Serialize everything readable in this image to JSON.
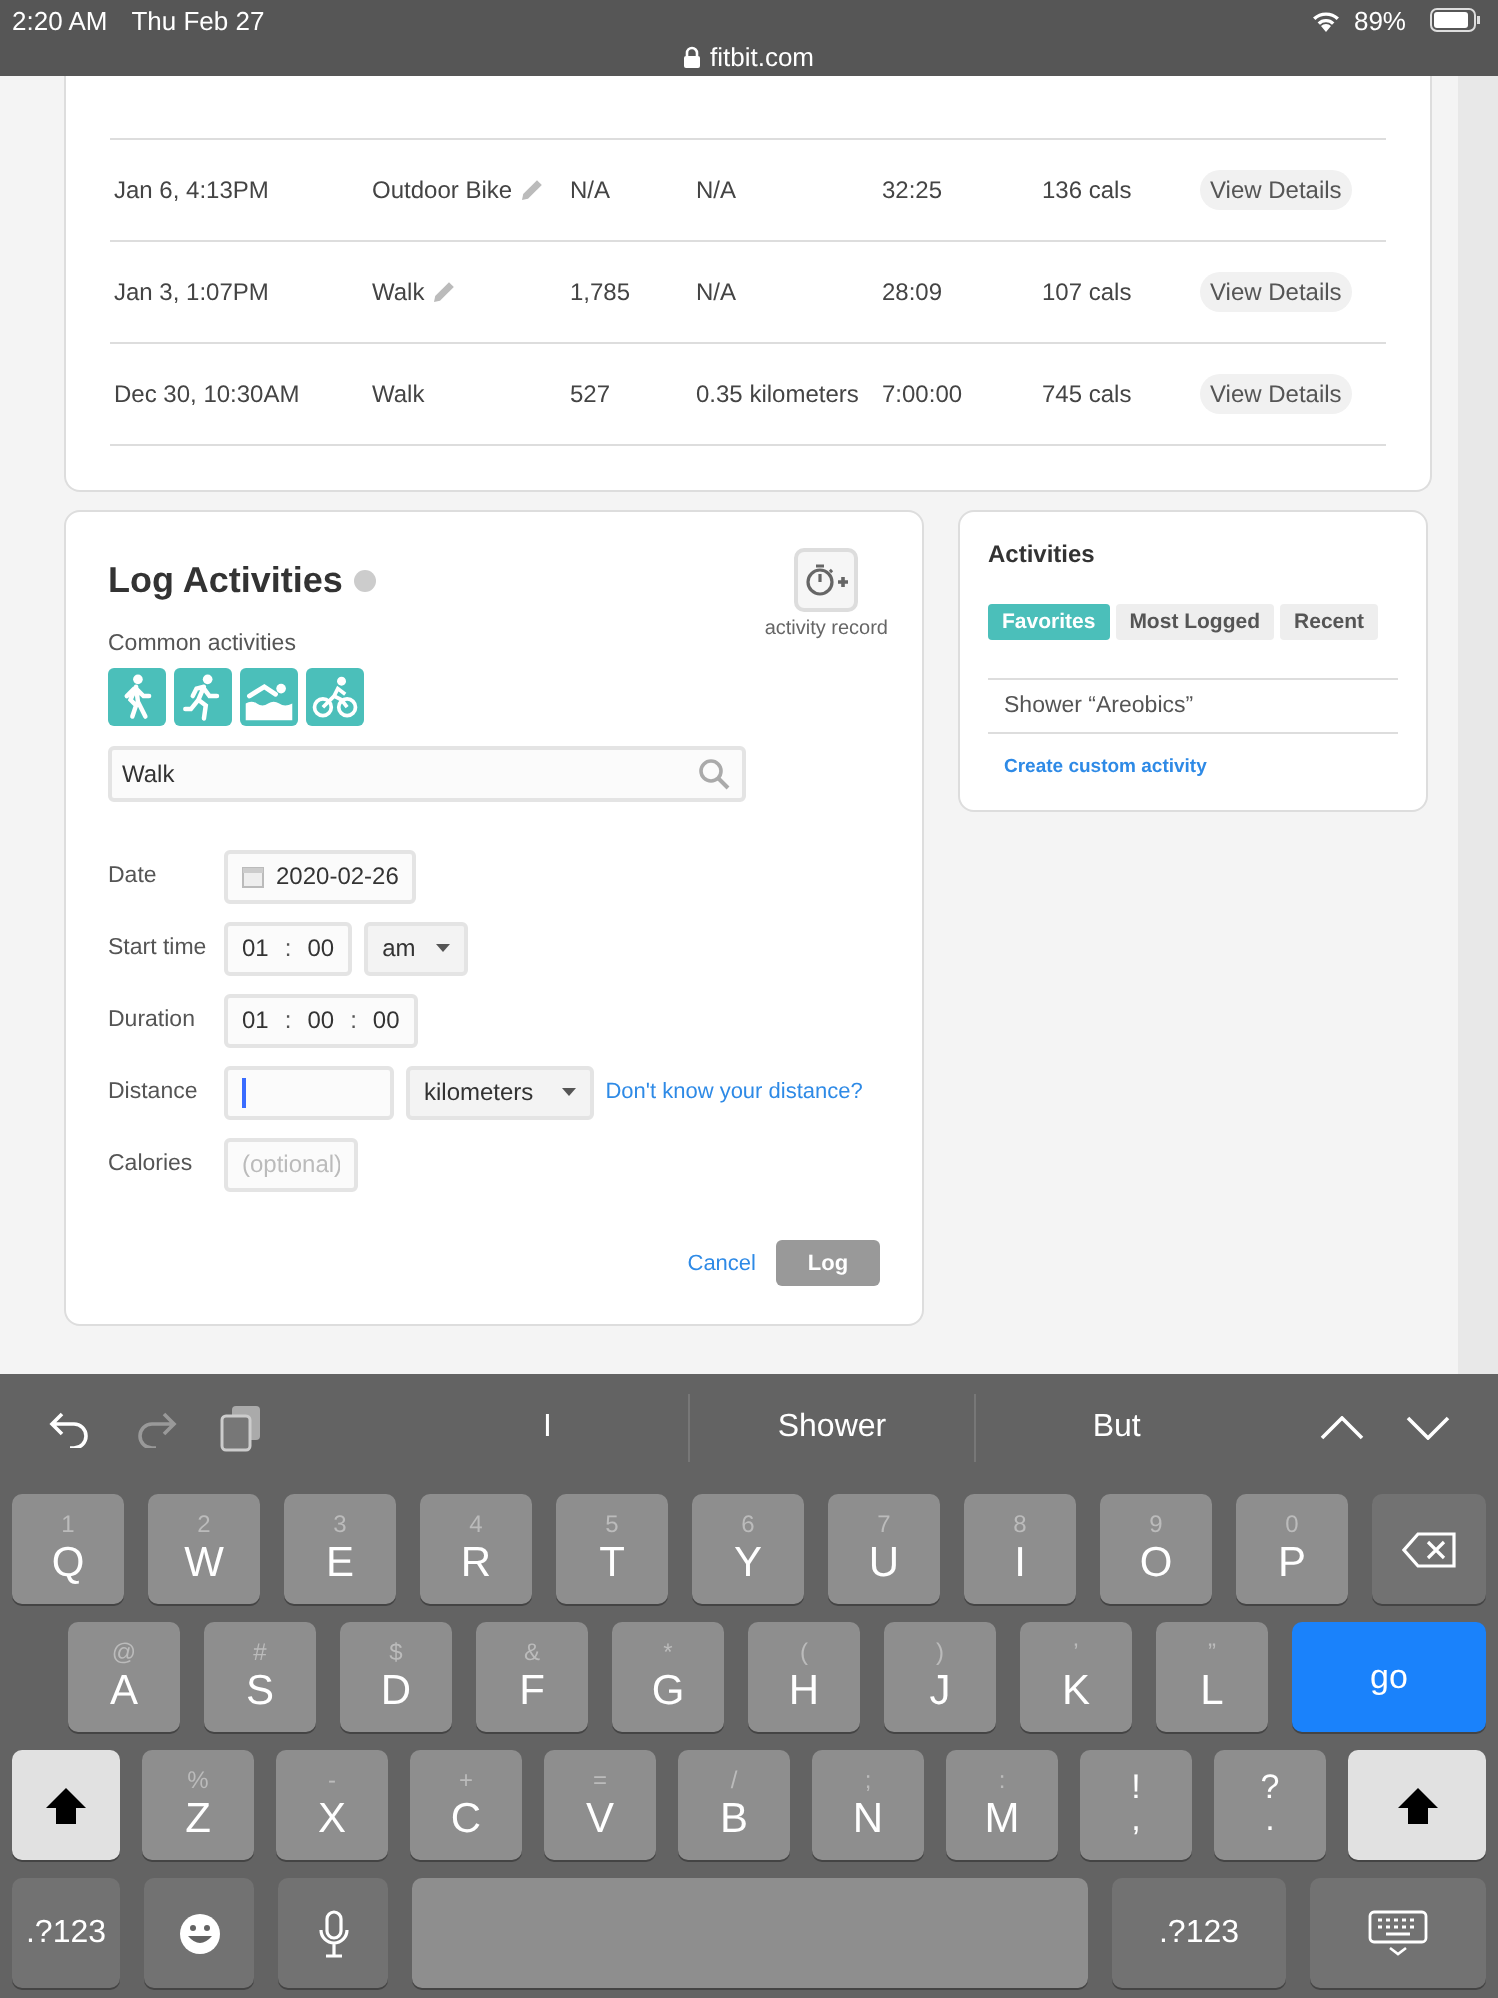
{
  "status_bar": {
    "time": "2:20 AM",
    "date": "Thu Feb 27",
    "battery": "89%",
    "url": "fitbit.com"
  },
  "activity_table": {
    "rows": [
      {
        "date": "Jan 6, 4:13PM",
        "activity": "Outdoor Bike",
        "editable": true,
        "steps": "N/A",
        "distance": "N/A",
        "duration": "32:25",
        "calories": "136 cals",
        "action": "View Details"
      },
      {
        "date": "Jan 3, 1:07PM",
        "activity": "Walk",
        "editable": true,
        "steps": "1,785",
        "distance": "N/A",
        "duration": "28:09",
        "calories": "107 cals",
        "action": "View Details"
      },
      {
        "date": "Dec 30, 10:30AM",
        "activity": "Walk",
        "editable": false,
        "steps": "527",
        "distance": "0.35 kilometers",
        "duration": "7:00:00",
        "calories": "745 cals",
        "action": "View Details"
      }
    ]
  },
  "log_activities": {
    "title": "Log Activities",
    "record_label": "activity record",
    "common_label": "Common activities",
    "common": [
      {
        "kind": "walk"
      },
      {
        "kind": "run"
      },
      {
        "kind": "swim"
      },
      {
        "kind": "bike"
      }
    ],
    "search": {
      "value": "Walk"
    },
    "fields": [
      {
        "kind": "date",
        "label": "Date",
        "value": "2020-02-26"
      },
      {
        "kind": "time",
        "label": "Start time",
        "parts": [
          "01",
          "00"
        ],
        "separator": ":",
        "period": "am"
      },
      {
        "kind": "duration",
        "label": "Duration",
        "parts": [
          "01",
          "00",
          "00"
        ],
        "separator": ":"
      },
      {
        "kind": "distance",
        "label": "Distance",
        "focused": true,
        "unit": "kilometers",
        "link": "Don't know your distance?"
      },
      {
        "kind": "calories",
        "label": "Calories",
        "placeholder": "(optional)"
      }
    ],
    "cancel": "Cancel",
    "submit": "Log"
  },
  "activities_panel": {
    "title": "Activities",
    "tabs": [
      {
        "label": "Favorites",
        "selected": true
      },
      {
        "label": "Most Logged",
        "selected": false
      },
      {
        "label": "Recent",
        "selected": false
      }
    ],
    "items": [
      "Shower “Areobics”"
    ],
    "link": "Create custom activity"
  },
  "keyboard": {
    "suggestions": [
      "I",
      "Shower",
      "But"
    ],
    "rows": [
      [
        {
          "kind": "letter",
          "label": "Q",
          "hint": "1"
        },
        {
          "kind": "letter",
          "label": "W",
          "hint": "2"
        },
        {
          "kind": "letter",
          "label": "E",
          "hint": "3"
        },
        {
          "kind": "letter",
          "label": "R",
          "hint": "4"
        },
        {
          "kind": "letter",
          "label": "T",
          "hint": "5"
        },
        {
          "kind": "letter",
          "label": "Y",
          "hint": "6"
        },
        {
          "kind": "letter",
          "label": "U",
          "hint": "7"
        },
        {
          "kind": "letter",
          "label": "I",
          "hint": "8"
        },
        {
          "kind": "letter",
          "label": "O",
          "hint": "9"
        },
        {
          "kind": "letter",
          "label": "P",
          "hint": "0"
        },
        {
          "kind": "delete"
        }
      ],
      [
        {
          "kind": "letter",
          "label": "A",
          "hint": "@"
        },
        {
          "kind": "letter",
          "label": "S",
          "hint": "#"
        },
        {
          "kind": "letter",
          "label": "D",
          "hint": "$"
        },
        {
          "kind": "letter",
          "label": "F",
          "hint": "&"
        },
        {
          "kind": "letter",
          "label": "G",
          "hint": "*"
        },
        {
          "kind": "letter",
          "label": "H",
          "hint": "("
        },
        {
          "kind": "letter",
          "label": "J",
          "hint": ")"
        },
        {
          "kind": "letter",
          "label": "K",
          "hint": "’"
        },
        {
          "kind": "letter",
          "label": "L",
          "hint": "”"
        },
        {
          "kind": "go",
          "label": "go"
        }
      ],
      [
        {
          "kind": "shift"
        },
        {
          "kind": "letter",
          "label": "Z",
          "hint": "%"
        },
        {
          "kind": "letter",
          "label": "X",
          "hint": "-"
        },
        {
          "kind": "letter",
          "label": "C",
          "hint": "+"
        },
        {
          "kind": "letter",
          "label": "V",
          "hint": "="
        },
        {
          "kind": "letter",
          "label": "B",
          "hint": "/"
        },
        {
          "kind": "letter",
          "label": "N",
          "hint": ";"
        },
        {
          "kind": "letter",
          "label": "M",
          "hint": ":"
        },
        {
          "kind": "punct",
          "label": ",",
          "hint": "!"
        },
        {
          "kind": "punct",
          "label": ".",
          "hint": "?"
        },
        {
          "kind": "shift"
        }
      ],
      [
        {
          "kind": "symbols",
          "label": ".?123"
        },
        {
          "kind": "emoji"
        },
        {
          "kind": "mic"
        },
        {
          "kind": "space"
        },
        {
          "kind": "symbols",
          "label": ".?123"
        },
        {
          "kind": "hide"
        }
      ]
    ]
  }
}
